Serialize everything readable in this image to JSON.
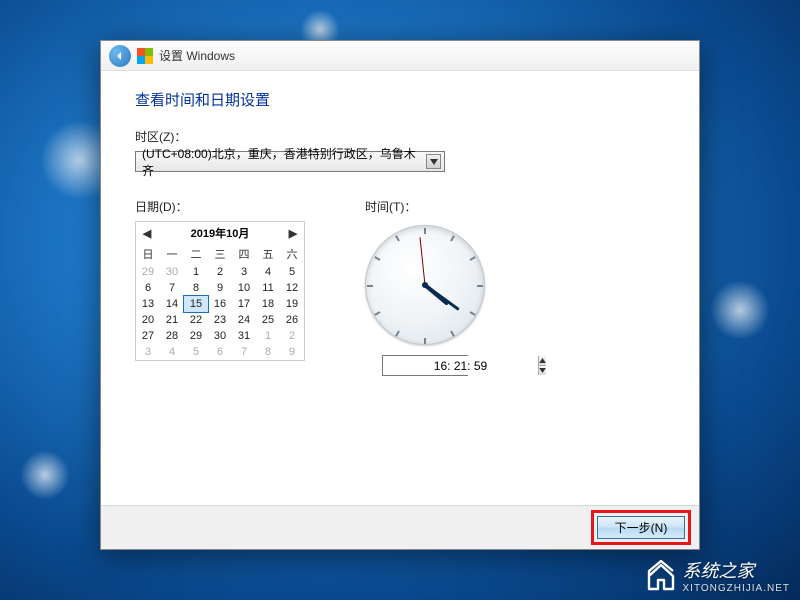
{
  "header": {
    "title": "设置 Windows"
  },
  "section_title": "查看时间和日期设置",
  "timezone": {
    "label": "时区(Z)：",
    "selected": "(UTC+08:00)北京，重庆，香港特别行政区，乌鲁木齐"
  },
  "date": {
    "label": "日期(D)：",
    "month_title": "2019年10月",
    "dow": [
      "日",
      "一",
      "二",
      "三",
      "四",
      "五",
      "六"
    ],
    "weeks": [
      [
        {
          "d": 29,
          "o": true
        },
        {
          "d": 30,
          "o": true
        },
        {
          "d": 1
        },
        {
          "d": 2
        },
        {
          "d": 3
        },
        {
          "d": 4
        },
        {
          "d": 5
        }
      ],
      [
        {
          "d": 6
        },
        {
          "d": 7
        },
        {
          "d": 8
        },
        {
          "d": 9
        },
        {
          "d": 10
        },
        {
          "d": 11
        },
        {
          "d": 12
        }
      ],
      [
        {
          "d": 13
        },
        {
          "d": 14
        },
        {
          "d": 15,
          "sel": true
        },
        {
          "d": 16
        },
        {
          "d": 17
        },
        {
          "d": 18
        },
        {
          "d": 19
        }
      ],
      [
        {
          "d": 20
        },
        {
          "d": 21
        },
        {
          "d": 22
        },
        {
          "d": 23
        },
        {
          "d": 24
        },
        {
          "d": 25
        },
        {
          "d": 26
        }
      ],
      [
        {
          "d": 27
        },
        {
          "d": 28
        },
        {
          "d": 29
        },
        {
          "d": 30
        },
        {
          "d": 31
        },
        {
          "d": 1,
          "o": true
        },
        {
          "d": 2,
          "o": true
        }
      ],
      [
        {
          "d": 3,
          "o": true
        },
        {
          "d": 4,
          "o": true
        },
        {
          "d": 5,
          "o": true
        },
        {
          "d": 6,
          "o": true
        },
        {
          "d": 7,
          "o": true
        },
        {
          "d": 8,
          "o": true
        },
        {
          "d": 9,
          "o": true
        }
      ]
    ]
  },
  "time": {
    "label": "时间(T)：",
    "value": "16: 21: 59",
    "hour": 16,
    "minute": 21,
    "second": 59
  },
  "footer": {
    "next_label": "下一步(N)"
  },
  "watermark": {
    "brand": "系统之家",
    "sub": "XITONGZHIJIA.NET"
  }
}
